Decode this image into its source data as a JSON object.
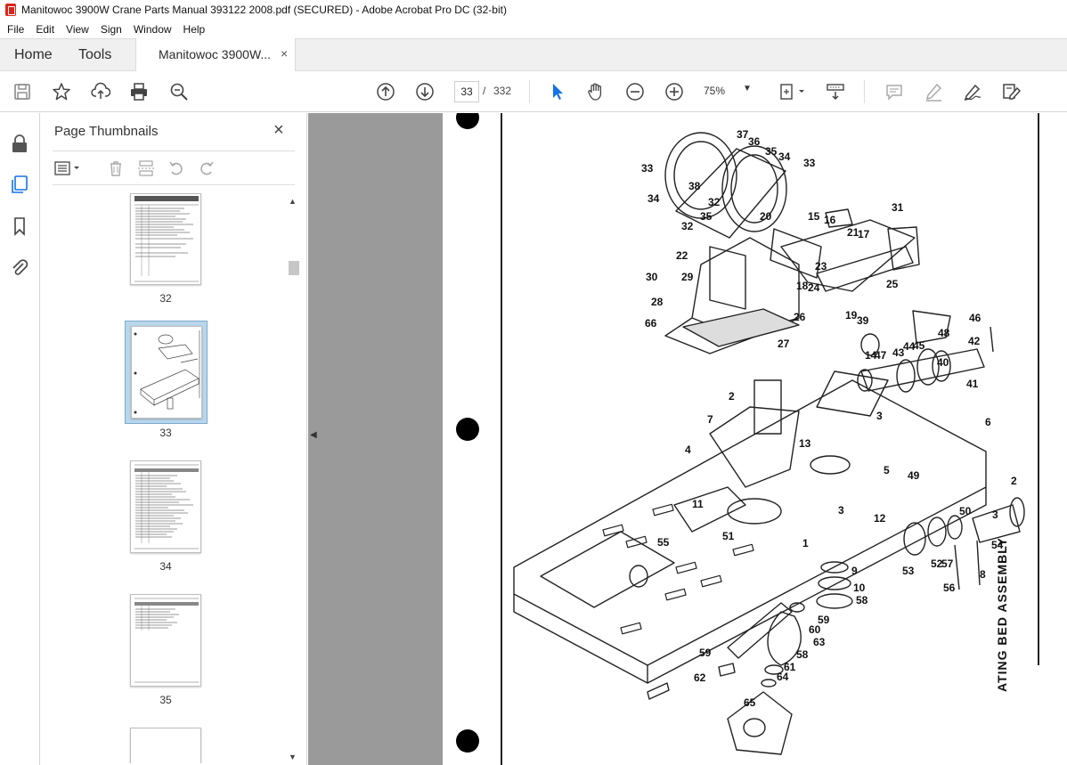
{
  "window": {
    "title": "Manitowoc 3900W Crane Parts Manual 393122 2008.pdf (SECURED) - Adobe Acrobat Pro DC (32-bit)"
  },
  "menu": [
    "File",
    "Edit",
    "View",
    "Sign",
    "Window",
    "Help"
  ],
  "tabs": {
    "home": "Home",
    "tools": "Tools",
    "document": "Manitowoc 3900W...",
    "close": "×"
  },
  "toolbar": {
    "icons": [
      "save-icon",
      "star-icon",
      "upload-icon",
      "print-icon",
      "zoom-search-icon",
      "page-up-icon",
      "page-down-icon",
      "select-cursor-icon",
      "hand-icon",
      "zoom-out-icon",
      "zoom-in-icon",
      "page-fit-icon",
      "scroll-mode-icon",
      "comment-icon",
      "highlight-icon",
      "sign-icon",
      "edit-icon"
    ],
    "current_page": "33",
    "page_separator": "/",
    "total_pages": "332",
    "zoom": "75%"
  },
  "sidebar": {
    "icons": [
      "lock-icon",
      "page-thumbnails-icon",
      "bookmark-icon",
      "attachment-icon"
    ]
  },
  "thumbnail_panel": {
    "title": "Page Thumbnails",
    "close": "×",
    "thumbnails": [
      {
        "label": "32"
      },
      {
        "label": "33",
        "selected": true
      },
      {
        "label": "34"
      },
      {
        "label": "35"
      }
    ]
  },
  "document": {
    "side_caption": "ATING BED ASSEMBLY",
    "part_numbers": [
      "37",
      "36",
      "35",
      "34",
      "33",
      "33",
      "38",
      "34",
      "32",
      "32",
      "35",
      "20",
      "15",
      "16",
      "21",
      "17",
      "31",
      "22",
      "23",
      "24",
      "18",
      "25",
      "30",
      "29",
      "28",
      "19",
      "26",
      "66",
      "27",
      "39",
      "14",
      "48",
      "46",
      "42",
      "43",
      "44",
      "45",
      "40",
      "47",
      "41",
      "3",
      "2",
      "7",
      "6",
      "13",
      "4",
      "5",
      "49",
      "2",
      "3",
      "12",
      "11",
      "51",
      "50",
      "3",
      "1",
      "55",
      "54",
      "53",
      "52",
      "57",
      "56",
      "8",
      "9",
      "10",
      "58",
      "59",
      "60",
      "63",
      "59",
      "58",
      "61",
      "64",
      "62",
      "65"
    ]
  },
  "colors": {
    "accent": "#1473e6",
    "doc_background": "#9a9a9a",
    "selected_thumb": "#b9d6ea",
    "app_red": "#d9261c"
  }
}
